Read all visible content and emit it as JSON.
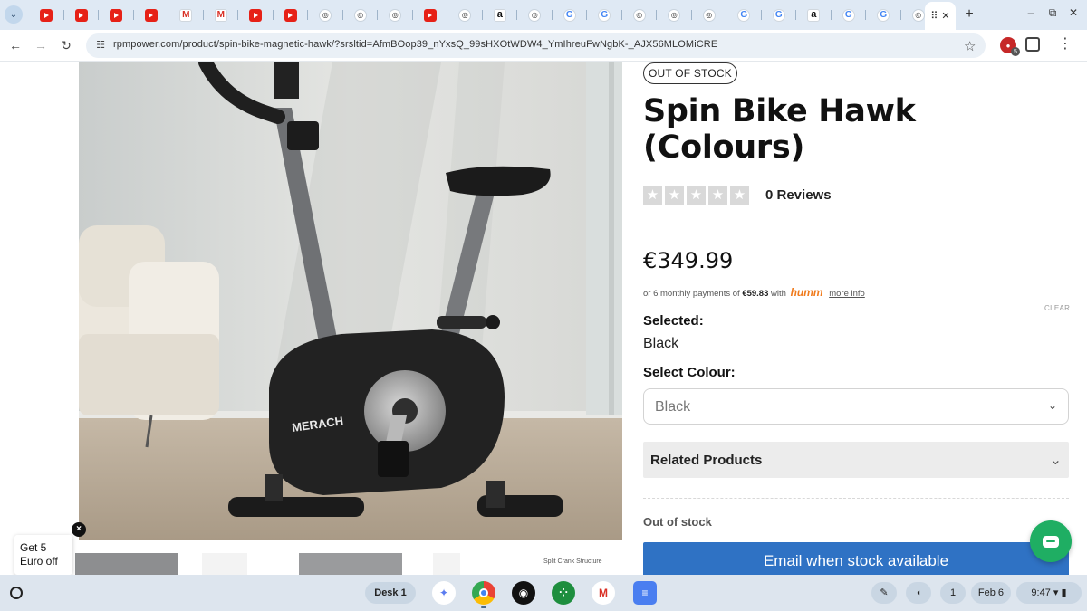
{
  "browser": {
    "tabs": [
      {
        "icon": "youtube-icon"
      },
      {
        "icon": "youtube-icon"
      },
      {
        "icon": "youtube-icon"
      },
      {
        "icon": "youtube-icon"
      },
      {
        "icon": "gmail-icon"
      },
      {
        "icon": "gmail-icon"
      },
      {
        "icon": "youtube-icon"
      },
      {
        "icon": "youtube-icon"
      },
      {
        "icon": "site-icon"
      },
      {
        "icon": "site-icon"
      },
      {
        "icon": "site-icon"
      },
      {
        "icon": "youtube-icon"
      },
      {
        "icon": "site-icon"
      },
      {
        "icon": "amazon-icon"
      },
      {
        "icon": "site-icon"
      },
      {
        "icon": "google-icon"
      },
      {
        "icon": "google-icon"
      },
      {
        "icon": "site-icon"
      },
      {
        "icon": "site-icon"
      },
      {
        "icon": "site-icon"
      },
      {
        "icon": "google-icon"
      },
      {
        "icon": "google-icon"
      },
      {
        "icon": "amazon-icon"
      },
      {
        "icon": "google-icon"
      },
      {
        "icon": "google-icon"
      },
      {
        "icon": "site-icon"
      }
    ],
    "url": "rpmpower.com/product/spin-bike-magnetic-hawk/?srsltid=AfmBOop39_nYxsQ_99sHXOtWDW4_YmIhreuFwNgbK-_AJX56MLOMiCRE",
    "extension_badge": "5"
  },
  "product": {
    "stock_badge": "OUT OF STOCK",
    "title": "Spin Bike Hawk (Colours)",
    "rating": 0,
    "rating_max": 5,
    "reviews_label": "0 Reviews",
    "price": "€349.99",
    "installment_prefix": "or 6 monthly payments of",
    "installment_amount": "€59.83",
    "installment_with": "with",
    "installment_provider": "humm",
    "more_info": "more info",
    "clear_label": "CLEAR",
    "selected_label": "Selected:",
    "selected_value": "Black",
    "colour_label": "Select Colour:",
    "colour_value": "Black",
    "related_label": "Related Products",
    "out_of_stock_label": "Out of stock",
    "email_button": "Email when stock available",
    "hero_brand": "MERACH",
    "thumb_caption": "Split Crank Structure"
  },
  "promo": {
    "line1": "Get 5",
    "line2": "Euro off",
    "close": "×"
  },
  "shelf": {
    "desk_label": "Desk 1",
    "notification_count": "1",
    "date": "Feb 6",
    "time": "9:47"
  },
  "colors": {
    "accent_button": "#2f72c4",
    "chat_button": "#1fae63",
    "humm_orange": "#f07b1d"
  }
}
